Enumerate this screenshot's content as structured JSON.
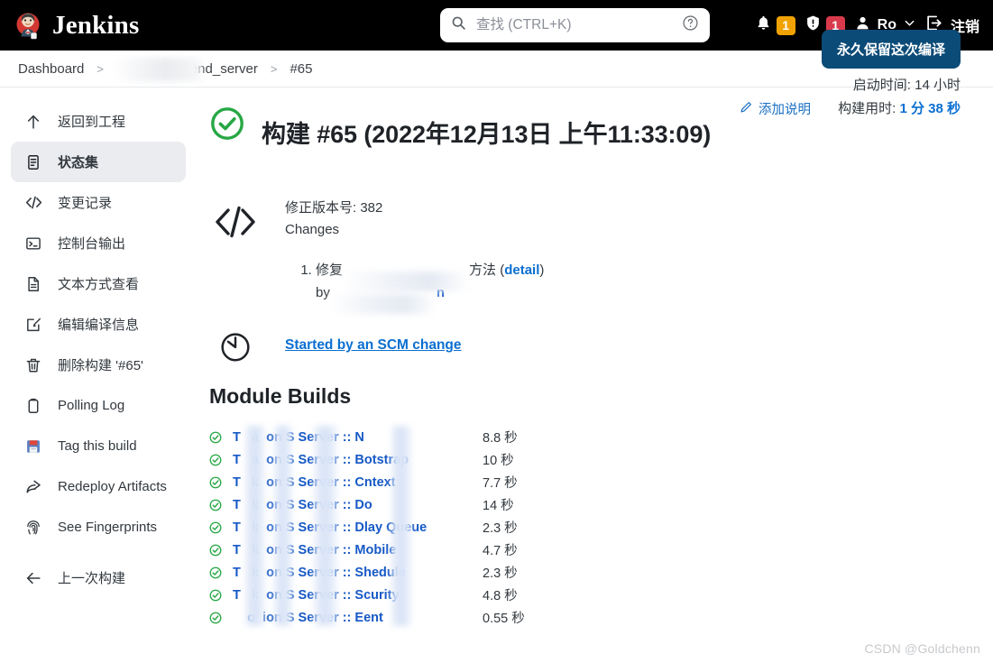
{
  "header": {
    "brand": "Jenkins",
    "logo_icon": "jenkins-butler-logo",
    "search": {
      "placeholder": "查找 (CTRL+K)",
      "value": "",
      "icon": "search-icon",
      "help_icon": "question-circle-icon"
    },
    "notifications": {
      "icon": "bell-icon",
      "count": "1",
      "color": "#f0a202"
    },
    "security": {
      "icon": "shield-exclamation-icon",
      "count": "1",
      "color": "#d93a4b"
    },
    "user": {
      "icon": "person-icon",
      "name": "Ro",
      "chevron_icon": "chevron-down-icon"
    },
    "logout": {
      "icon": "logout-icon",
      "label": "注销"
    }
  },
  "breadcrumb": {
    "items": [
      {
        "label": "Dashboard",
        "redacted": false
      },
      {
        "label": "akend_server",
        "redacted": true
      },
      {
        "label": "#65",
        "redacted": false
      }
    ],
    "separator": ">"
  },
  "sidebar": {
    "items": [
      {
        "label": "返回到工程",
        "icon": "arrow-up-icon",
        "active": false
      },
      {
        "label": "状态集",
        "icon": "document-icon",
        "active": true
      },
      {
        "label": "变更记录",
        "icon": "code-brackets-icon",
        "active": false
      },
      {
        "label": "控制台输出",
        "icon": "terminal-icon",
        "active": false
      },
      {
        "label": "文本方式查看",
        "icon": "file-text-icon",
        "active": false
      },
      {
        "label": "编辑编译信息",
        "icon": "edit-square-icon",
        "active": false
      },
      {
        "label": "删除构建 '#65'",
        "icon": "trash-icon",
        "active": false
      },
      {
        "label": "Polling Log",
        "icon": "clipboard-icon",
        "active": false
      },
      {
        "label": "Tag this build",
        "icon": "floppy-disk-icon",
        "active": false
      },
      {
        "label": "Redeploy Artifacts",
        "icon": "share-arrow-icon",
        "active": false
      },
      {
        "label": "See Fingerprints",
        "icon": "fingerprint-icon",
        "active": false
      }
    ],
    "footer_item": {
      "label": "上一次构建",
      "icon": "arrow-left-icon"
    }
  },
  "main": {
    "status_icon": "success-check-circle-icon",
    "title": "构建 #65 (2022年12月13日 上午11:33:09)",
    "keep_button": "永久保留这次编译",
    "meta": {
      "start_label": "启动时间:",
      "start_value": "14 小时",
      "duration_label": "构建用时:",
      "duration_value": "1 分 38 秒"
    },
    "add_description": {
      "label": "添加说明",
      "icon": "pencil-icon"
    },
    "changes": {
      "icon": "code-brackets-large-icon",
      "revision_line": "修正版本号: 382",
      "changes_label": "Changes",
      "entries": [
        {
          "prefix": "修复",
          "redacted_mid": true,
          "suffix": "方法",
          "detail_link": "detail",
          "by_label": "by",
          "author_redacted": true,
          "author_tail": "n"
        }
      ]
    },
    "cause": {
      "icon": "clock-icon",
      "link": "Started by an SCM change"
    },
    "module_builds": {
      "title": "Module Builds",
      "rows": [
        {
          "status": "success",
          "prefix": "T",
          "mid": "a",
          "mid2": "on",
          "name": "S Server :: N",
          "tail": "",
          "duration": "8.8 秒"
        },
        {
          "status": "success",
          "prefix": "T",
          "mid": "a",
          "mid2": "on",
          "name": "S Server :: B",
          "tail": "otstrap",
          "duration": "10 秒"
        },
        {
          "status": "success",
          "prefix": "T",
          "mid": "k",
          "mid2": "on",
          "name": "S Server :: C",
          "tail": "ntext",
          "duration": "7.7 秒"
        },
        {
          "status": "success",
          "prefix": "T",
          "mid": "k",
          "mid2": "on",
          "name": "S Server :: D",
          "tail": "o",
          "duration": "14 秒"
        },
        {
          "status": "success",
          "prefix": "T",
          "mid": "k",
          "mid2": "on",
          "name": "S Server :: D",
          "tail": "lay Queue",
          "duration": "2.3 秒"
        },
        {
          "status": "success",
          "prefix": "T",
          "mid": "k",
          "mid2": "on",
          "name": "S Server :: M",
          "tail": "obile",
          "duration": "4.7 秒"
        },
        {
          "status": "success",
          "prefix": "T",
          "mid": "k",
          "mid2": "on",
          "name": "S Server :: S",
          "tail": "hedule",
          "duration": "2.3 秒"
        },
        {
          "status": "success",
          "prefix": "T",
          "mid": "k",
          "mid2": "on",
          "name": "S Server :: S",
          "tail": "curity",
          "duration": "4.8 秒"
        },
        {
          "status": "success",
          "prefix": "",
          "mid": "o",
          "mid2": "ion",
          "name": "S Server :: E",
          "tail": "ent",
          "duration": "0.55 秒"
        }
      ]
    }
  },
  "watermark": "CSDN @Goldchenn",
  "colors": {
    "header_bg": "#000000",
    "success_green": "#27a745",
    "link_blue": "#0b6fd1",
    "module_blue": "#1659c6",
    "keep_button_bg": "#0b4b78",
    "sidebar_active_bg": "#ebecef",
    "badge_orange": "#f0a202",
    "badge_red": "#d93a4b"
  }
}
